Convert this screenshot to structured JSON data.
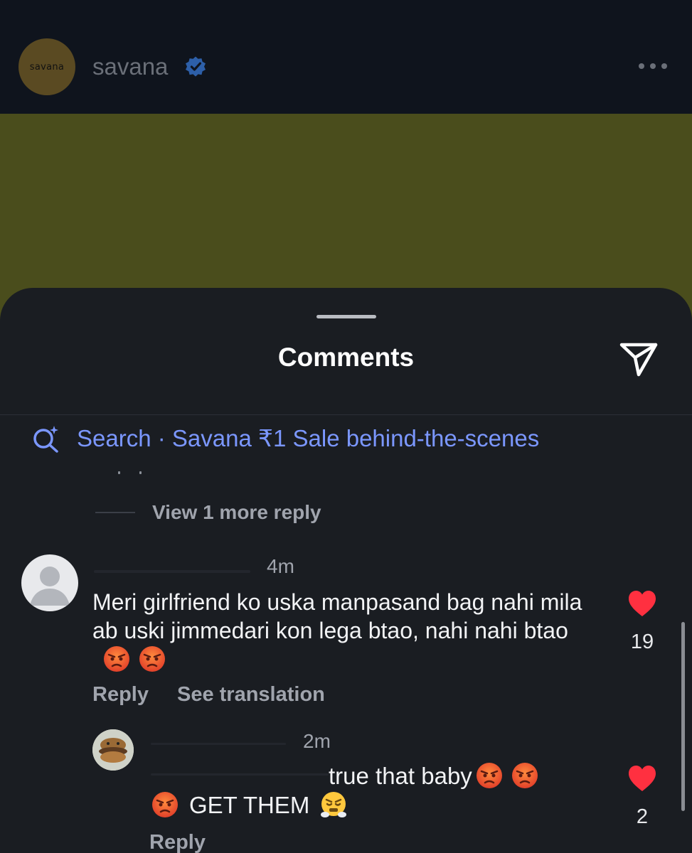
{
  "header": {
    "avatar_text": "savana",
    "account_name": "savana",
    "verified_icon": "verified-badge-icon",
    "more_icon": "more-options-icon"
  },
  "colors": {
    "background": "#0f141d",
    "media": "#4a4d1c",
    "sheet": "#1a1d22",
    "link_blue": "#7b97ff",
    "like_red": "#ff3040"
  },
  "comments_sheet": {
    "title": "Comments",
    "share_icon": "send-icon",
    "search_icon": "search-sparkle-icon",
    "search_text": "Search · Savana ₹1 Sale behind-the-scenes",
    "view_more_replies": "View 1 more reply"
  },
  "comments": [
    {
      "time": "4m",
      "text": "Meri girlfriend ko uska manpasand bag nahi mila ab uski jimmedari kon lega btao, nahi nahi btao",
      "reply_label": "Reply",
      "translate_label": "See translation",
      "likes": "19",
      "liked": true
    },
    {
      "time": "2m",
      "text_line1": "true that baby",
      "text_line2": "GET THEM",
      "reply_label": "Reply",
      "likes": "2",
      "liked": true
    }
  ]
}
